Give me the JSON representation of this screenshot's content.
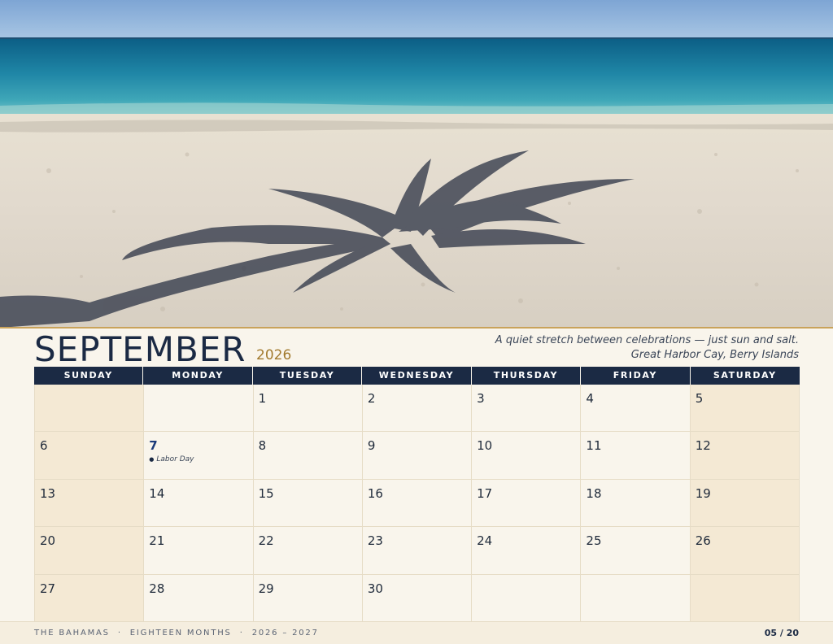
{
  "header": {
    "month": "SEPTEMBER",
    "year": "2026",
    "caption_line1": "A quiet stretch between celebrations — just sun and salt.",
    "caption_line2": "Great Harbor Cay, Berry Islands"
  },
  "weekdays": [
    "SUNDAY",
    "MONDAY",
    "TUESDAY",
    "WEDNESDAY",
    "THURSDAY",
    "FRIDAY",
    "SATURDAY"
  ],
  "weeks": [
    [
      {
        "num": ""
      },
      {
        "num": ""
      },
      {
        "num": "1"
      },
      {
        "num": "2"
      },
      {
        "num": "3"
      },
      {
        "num": "4"
      },
      {
        "num": "5"
      }
    ],
    [
      {
        "num": "6"
      },
      {
        "num": "7",
        "holiday": true,
        "note": "Labor Day"
      },
      {
        "num": "8"
      },
      {
        "num": "9"
      },
      {
        "num": "10"
      },
      {
        "num": "11"
      },
      {
        "num": "12"
      }
    ],
    [
      {
        "num": "13"
      },
      {
        "num": "14"
      },
      {
        "num": "15"
      },
      {
        "num": "16"
      },
      {
        "num": "17"
      },
      {
        "num": "18"
      },
      {
        "num": "19"
      }
    ],
    [
      {
        "num": "20"
      },
      {
        "num": "21"
      },
      {
        "num": "22"
      },
      {
        "num": "23"
      },
      {
        "num": "24"
      },
      {
        "num": "25"
      },
      {
        "num": "26"
      }
    ],
    [
      {
        "num": "27"
      },
      {
        "num": "28"
      },
      {
        "num": "29"
      },
      {
        "num": "30"
      },
      {
        "num": ""
      },
      {
        "num": ""
      },
      {
        "num": ""
      }
    ]
  ],
  "footer": {
    "part1": "THE BAHAMAS",
    "part2": "EIGHTEEN MONTHS",
    "part3": "2026 – 2027",
    "separator": "·",
    "page": "05 / 20"
  },
  "colors": {
    "navy": "#1b2a44",
    "gold": "#a27a2e",
    "weekend": "#f4e9d4",
    "paper": "#f9f5ec"
  }
}
